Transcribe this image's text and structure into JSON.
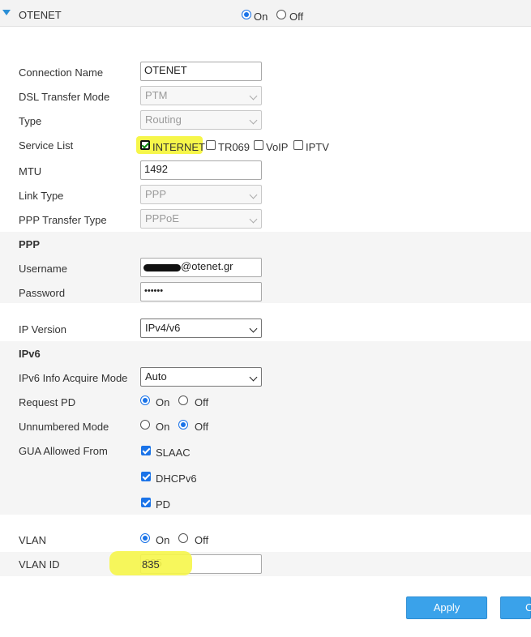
{
  "header": {
    "title": "OTENET",
    "on_label": "On",
    "off_label": "Off"
  },
  "form": {
    "connection_name": {
      "label": "Connection Name",
      "value": "OTENET"
    },
    "dsl_transfer_mode": {
      "label": "DSL Transfer Mode",
      "value": "PTM"
    },
    "type": {
      "label": "Type",
      "value": "Routing"
    },
    "service_list": {
      "label": "Service List",
      "options": [
        {
          "label": "INTERNET",
          "checked": true
        },
        {
          "label": "TR069",
          "checked": false
        },
        {
          "label": "VoIP",
          "checked": false
        },
        {
          "label": "IPTV",
          "checked": false
        }
      ]
    },
    "mtu": {
      "label": "MTU",
      "value": "1492"
    },
    "link_type": {
      "label": "Link Type",
      "value": "PPP"
    },
    "ppp_transfer_type": {
      "label": "PPP Transfer Type",
      "value": "PPPoE"
    }
  },
  "ppp": {
    "heading": "PPP",
    "username": {
      "label": "Username",
      "value": "@otenet.gr"
    },
    "password": {
      "label": "Password",
      "value": "••••••"
    }
  },
  "ip_version": {
    "label": "IP Version",
    "value": "IPv4/v6"
  },
  "ipv6": {
    "heading": "IPv6",
    "info_acquire_mode": {
      "label": "IPv6 Info Acquire Mode",
      "value": "Auto"
    },
    "request_pd": {
      "label": "Request PD",
      "on_label": "On",
      "off_label": "Off",
      "selected": "On"
    },
    "unnumbered_mode": {
      "label": "Unnumbered Mode",
      "on_label": "On",
      "off_label": "Off",
      "selected": "Off"
    },
    "gua_allowed_from": {
      "label": "GUA Allowed From",
      "options": [
        {
          "label": "SLAAC",
          "checked": true
        },
        {
          "label": "DHCPv6",
          "checked": true
        },
        {
          "label": "PD",
          "checked": true
        }
      ]
    }
  },
  "vlan": {
    "label": "VLAN",
    "on_label": "On",
    "off_label": "Off",
    "selected": "On",
    "id_label": "VLAN ID",
    "id_value": "835"
  },
  "buttons": {
    "apply": "Apply",
    "cancel": "C"
  },
  "colors": {
    "accent": "#1a73e8",
    "button": "#3aa2ea",
    "highlight": "#f6f64a"
  }
}
